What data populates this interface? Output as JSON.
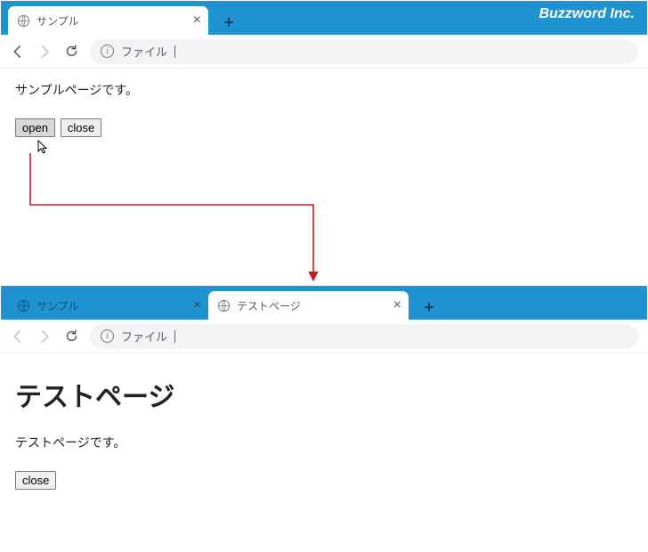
{
  "brand": "Buzzword Inc.",
  "browser1": {
    "tabs": [
      {
        "title": "サンプル",
        "active": true
      }
    ],
    "address": "ファイル",
    "page": {
      "text": "サンプルページです。",
      "buttons": {
        "open": "open",
        "close": "close"
      }
    }
  },
  "browser2": {
    "tabs": [
      {
        "title": "サンプル",
        "active": false
      },
      {
        "title": "テストページ",
        "active": true
      }
    ],
    "address": "ファイル",
    "page": {
      "heading": "テストページ",
      "text": "テストページです。",
      "buttons": {
        "close": "close"
      }
    }
  }
}
